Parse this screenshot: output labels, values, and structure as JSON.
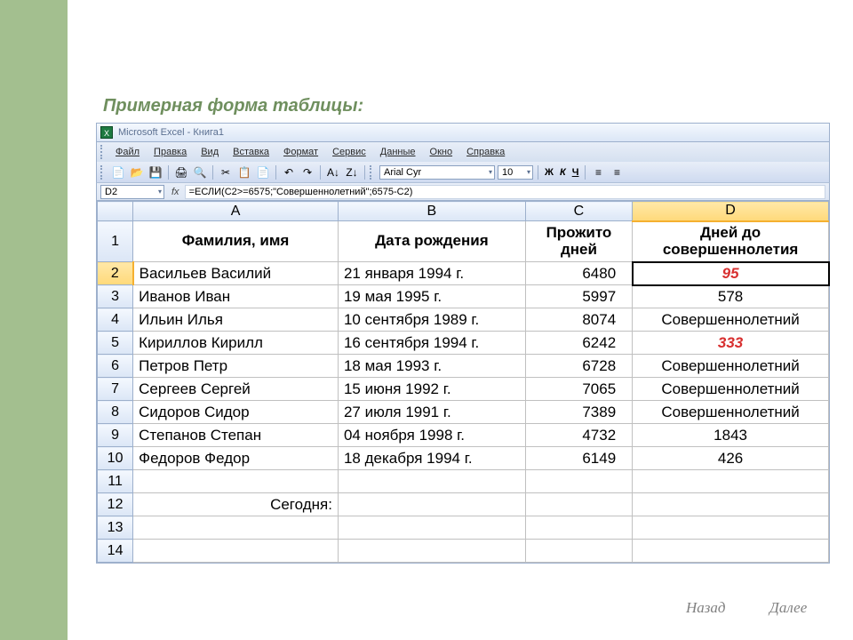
{
  "slide": {
    "title": "Примерная форма таблицы:",
    "nav_back": "Назад",
    "nav_next": "Далее"
  },
  "window": {
    "app_title": "Microsoft Excel - Книга1"
  },
  "menu": [
    "Файл",
    "Правка",
    "Вид",
    "Вставка",
    "Формат",
    "Сервис",
    "Данные",
    "Окно",
    "Справка"
  ],
  "toolbar": {
    "font": "Arial Cyr",
    "font_size": "10",
    "bold": "Ж",
    "italic": "К",
    "underline": "Ч"
  },
  "formulabar": {
    "active_cell": "D2",
    "fx_label": "fx",
    "formula": "=ЕСЛИ(C2>=6575;\"Совершеннолетний\";6575-C2)"
  },
  "columns": [
    "A",
    "B",
    "C",
    "D"
  ],
  "headers": {
    "A": "Фамилия, имя",
    "B": "Дата рождения",
    "C": "Прожито дней",
    "D": "Дней до совершеннолетия"
  },
  "rows": [
    {
      "n": "2",
      "A": "Васильев Василий",
      "B": "21 января 1994 г.",
      "C": "6480",
      "D": "95",
      "D_red": true,
      "D_selected": true
    },
    {
      "n": "3",
      "A": "Иванов Иван",
      "B": "19 мая 1995 г.",
      "C": "5997",
      "D": "578"
    },
    {
      "n": "4",
      "A": "Ильин Илья",
      "B": "10 сентября 1989 г.",
      "C": "8074",
      "D": "Совершеннолетний"
    },
    {
      "n": "5",
      "A": "Кириллов Кирилл",
      "B": "16 сентября 1994 г.",
      "C": "6242",
      "D": "333",
      "D_red": true
    },
    {
      "n": "6",
      "A": "Петров Петр",
      "B": "18 мая 1993 г.",
      "C": "6728",
      "D": "Совершеннолетний"
    },
    {
      "n": "7",
      "A": "Сергеев Сергей",
      "B": "15 июня 1992 г.",
      "C": "7065",
      "D": "Совершеннолетний"
    },
    {
      "n": "8",
      "A": "Сидоров Сидор",
      "B": "27 июля 1991 г.",
      "C": "7389",
      "D": "Совершеннолетний"
    },
    {
      "n": "9",
      "A": "Степанов Степан",
      "B": "04 ноября 1998 г.",
      "C": "4732",
      "D": "1843"
    },
    {
      "n": "10",
      "A": "Федоров Федор",
      "B": "18 декабря 1994 г.",
      "C": "6149",
      "D": "426"
    }
  ],
  "label_row": {
    "n": "12",
    "A": "Сегодня:"
  },
  "empty_rows": [
    "11",
    "13",
    "14"
  ]
}
